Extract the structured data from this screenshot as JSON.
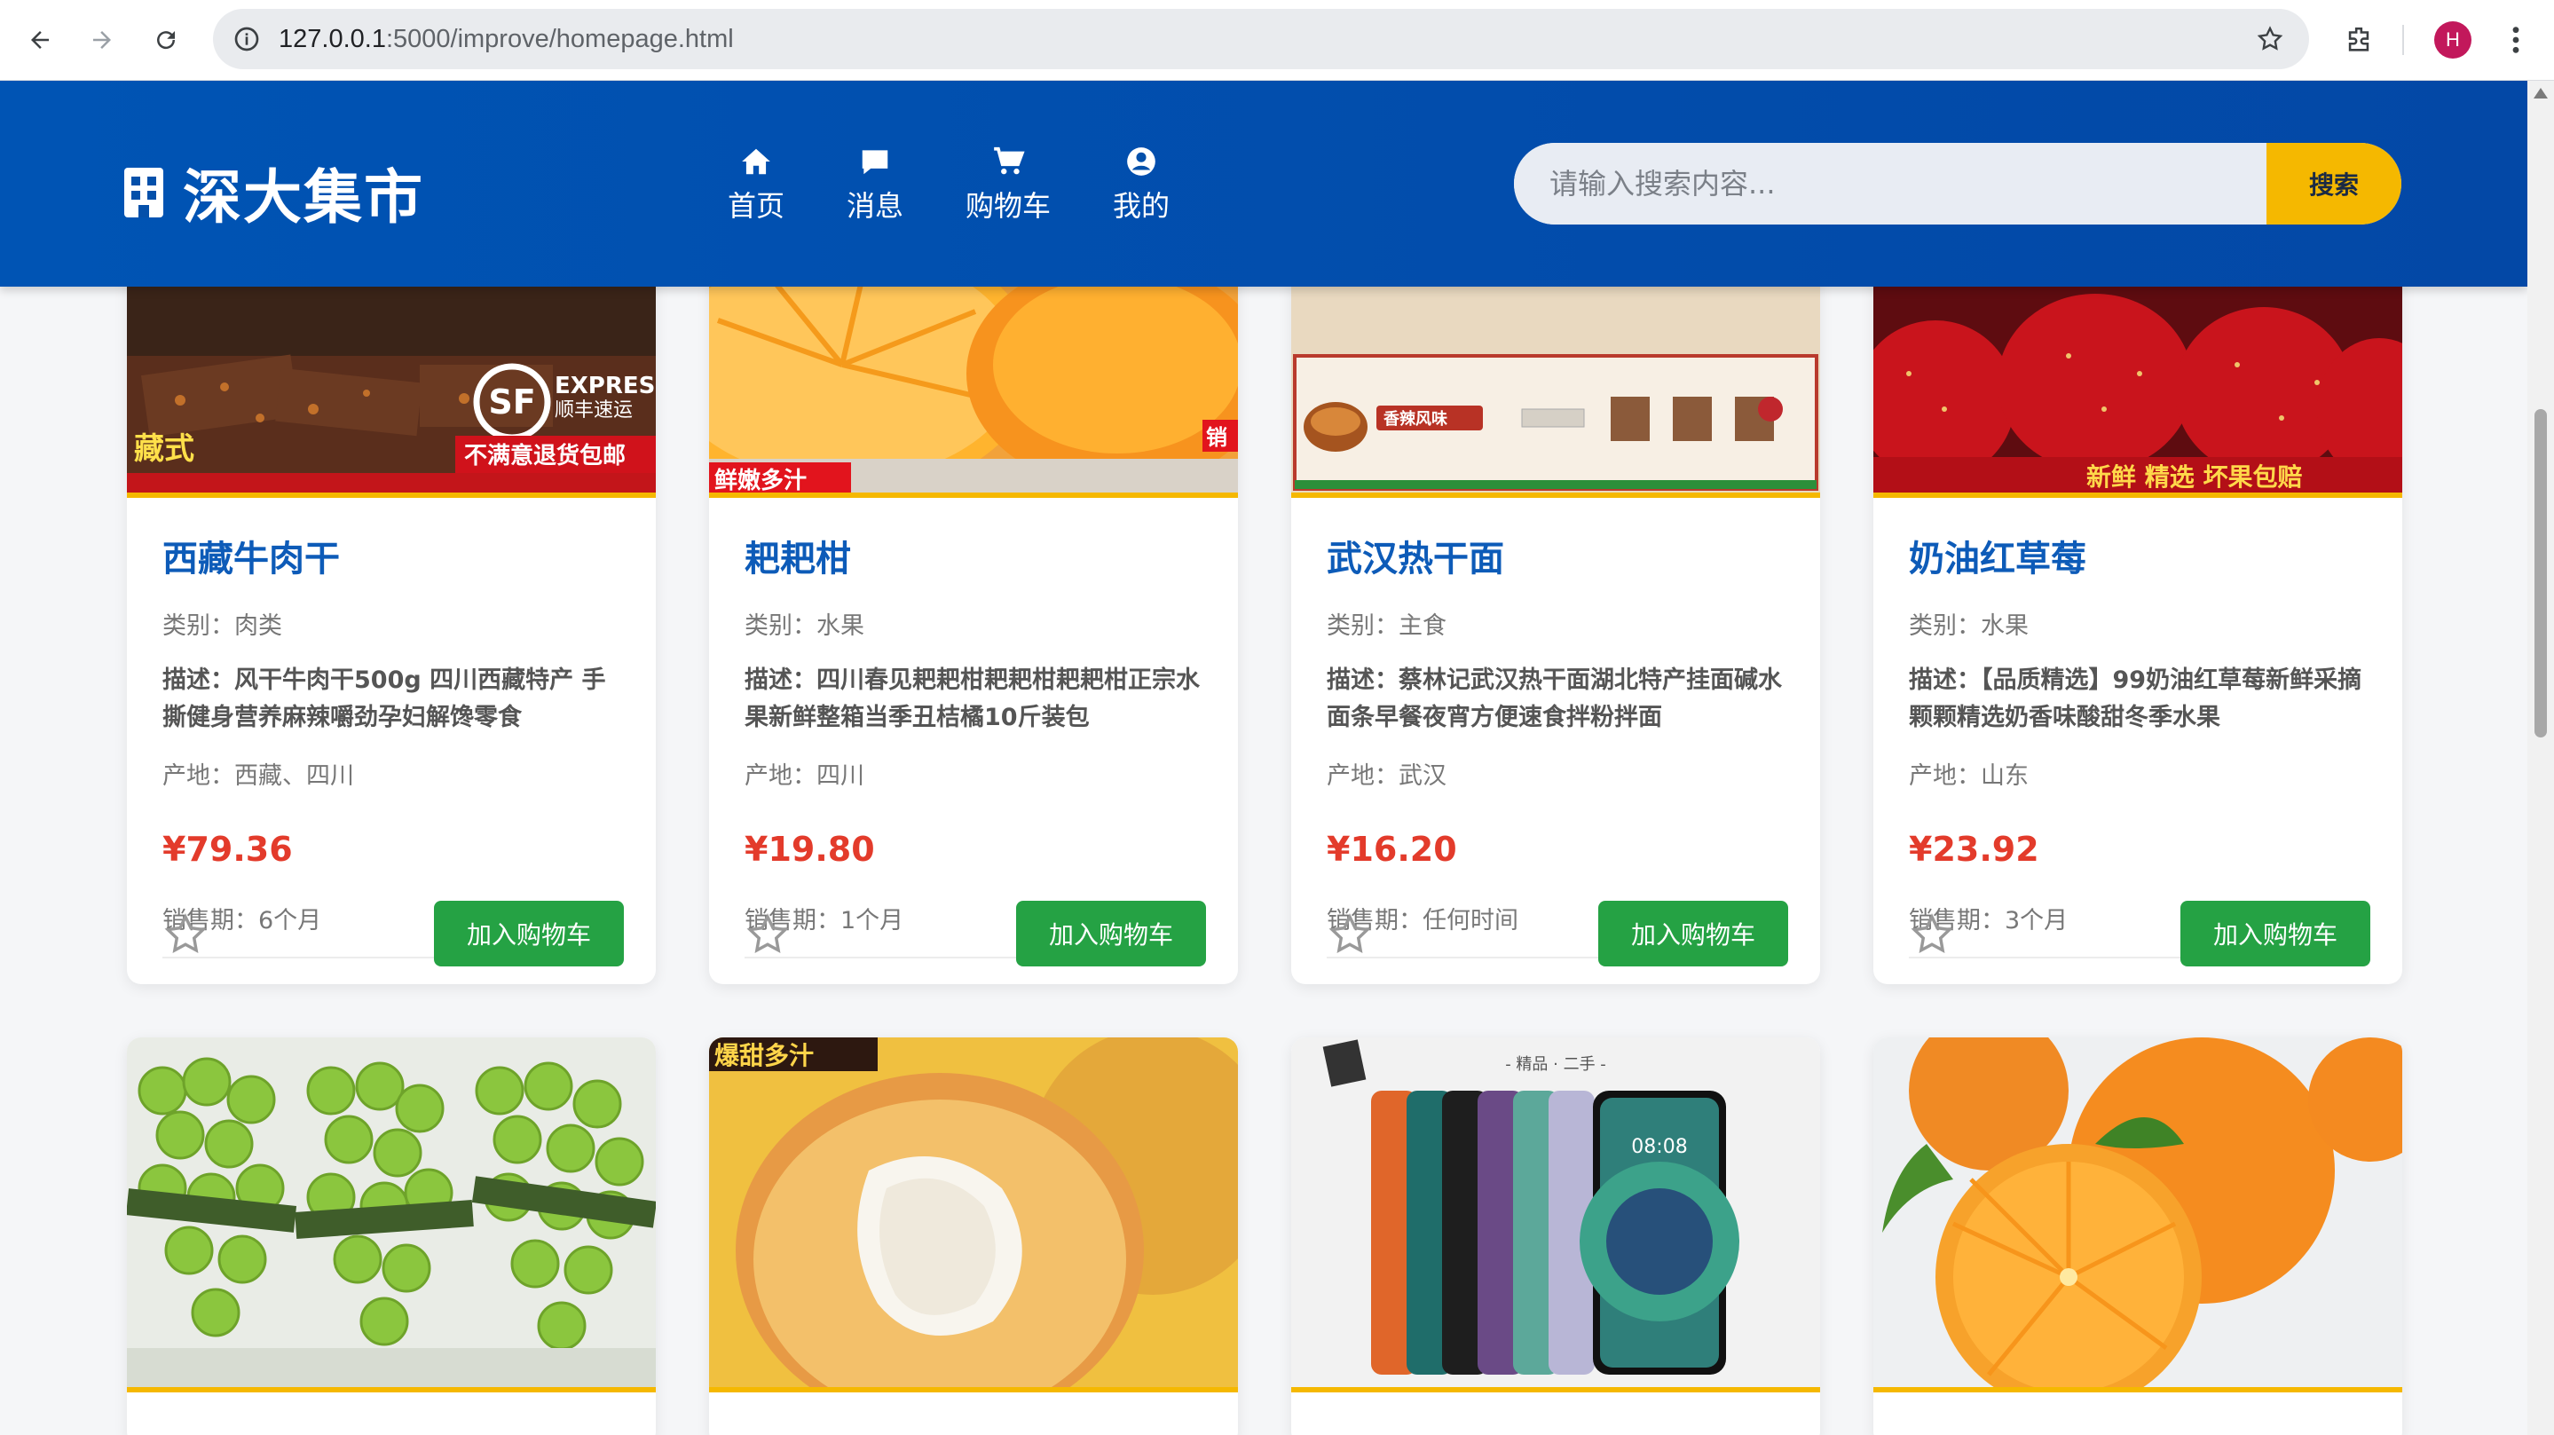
{
  "browser": {
    "url_host": "127.0.0.1",
    "url_rest": ":5000/improve/homepage.html",
    "profile_initial": "H",
    "icons": [
      "back-icon",
      "forward-icon",
      "reload-icon",
      "site-info-icon",
      "bookmark-star-icon",
      "extensions-icon",
      "menu-icon"
    ]
  },
  "header": {
    "logo_text": "深大集市",
    "nav": [
      {
        "label": "首页",
        "icon": "home-icon"
      },
      {
        "label": "消息",
        "icon": "message-icon"
      },
      {
        "label": "购物车",
        "icon": "cart-icon"
      },
      {
        "label": "我的",
        "icon": "user-icon"
      }
    ],
    "search_placeholder": "请输入搜索内容...",
    "search_button": "搜索",
    "colors": {
      "header_bg": "#0348a6",
      "accent": "#f5b800"
    }
  },
  "products": [
    {
      "title": "西藏牛肉干",
      "category": "类别：肉类",
      "description": "描述：风干牛肉干500g 四川西藏特产 手撕健身营养麻辣嚼劲孕妇解馋零食",
      "origin": "产地：西藏、四川",
      "price": "¥79.36",
      "sale_period": "销售期：6个月",
      "add_to_cart": "加入购物车",
      "image_text": {
        "brand": "EXPRESS",
        "brand_sub": "顺丰速运",
        "tag1": "藏式",
        "tag2": "不满意退货包邮"
      }
    },
    {
      "title": "耙耙柑",
      "category": "类别：水果",
      "description": "描述：四川春见耙耙柑耙耙柑耙耙柑正宗水果新鲜整箱当季丑桔橘10斤装包",
      "origin": "产地：四川",
      "price": "¥19.80",
      "sale_period": "销售期：1个月",
      "add_to_cart": "加入购物车",
      "image_text": {
        "tag1": "鲜嫩多汁",
        "tag2": "销"
      }
    },
    {
      "title": "武汉热干面",
      "category": "类别：主食",
      "description": "描述：蔡林记武汉热干面湖北特产挂面碱水面条早餐夜宵方便速食拌粉拌面",
      "origin": "产地：武汉",
      "price": "¥16.20",
      "sale_period": "销售期：任何时间",
      "add_to_cart": "加入购物车",
      "image_text": {
        "tag1": "香辣风味"
      }
    },
    {
      "title": "奶油红草莓",
      "category": "类别：水果",
      "description": "描述：【品质精选】99奶油红草莓新鲜采摘颗颗精选奶香味酸甜冬季水果",
      "origin": "产地：山东",
      "price": "¥23.92",
      "sale_period": "销售期：3个月",
      "add_to_cart": "加入购物车",
      "image_text": {
        "tag1": "新鲜 精选 坏果包赔"
      }
    }
  ],
  "products_row2": [
    {
      "image": "green-grapes",
      "image_text": {}
    },
    {
      "image": "pear",
      "image_text": {
        "tag1": "爆甜多汁"
      }
    },
    {
      "image": "phones",
      "image_text": {
        "tag1": "- 精品 · 二手 -",
        "clock": "08:08"
      }
    },
    {
      "image": "oranges",
      "image_text": {}
    }
  ]
}
